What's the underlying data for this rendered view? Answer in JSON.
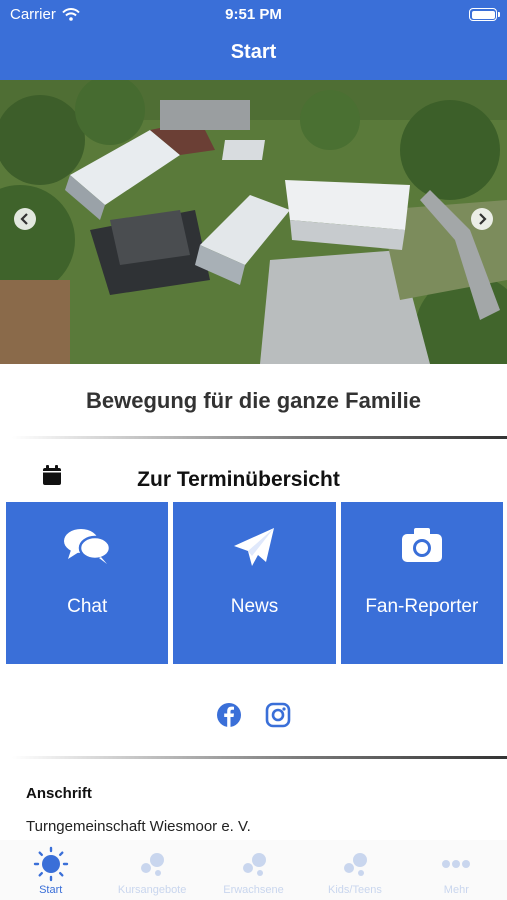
{
  "status_bar": {
    "carrier": "Carrier",
    "time": "9:51 PM",
    "battery_level": 1.0
  },
  "nav": {
    "title": "Start"
  },
  "hero": {
    "image_name": "aerial-sports-center-photo"
  },
  "tagline": "Bewegung für die ganze Familie",
  "calendar": {
    "label": "Zur Terminübersicht",
    "icon": "calendar-icon"
  },
  "tiles": [
    {
      "label": "Chat",
      "icon": "chat-icon"
    },
    {
      "label": "News",
      "icon": "paper-plane-icon"
    },
    {
      "label": "Fan-Reporter",
      "icon": "camera-icon"
    }
  ],
  "socials": [
    {
      "icon": "facebook-icon"
    },
    {
      "icon": "instagram-icon"
    }
  ],
  "address": {
    "title": "Anschrift",
    "line1": "Turngemeinschaft Wiesmoor e. V."
  },
  "tabs": [
    {
      "label": "Start",
      "icon": "sun-icon",
      "active": true
    },
    {
      "label": "Kursangebote",
      "icon": "bubbles-icon",
      "active": false
    },
    {
      "label": "Erwachsene",
      "icon": "bubbles-icon",
      "active": false
    },
    {
      "label": "Kids/Teens",
      "icon": "bubbles-icon",
      "active": false
    },
    {
      "label": "Mehr",
      "icon": "more-icon",
      "active": false
    }
  ],
  "colors": {
    "accent": "#3a6fd8",
    "tab_inactive": "#c9d6ee"
  }
}
